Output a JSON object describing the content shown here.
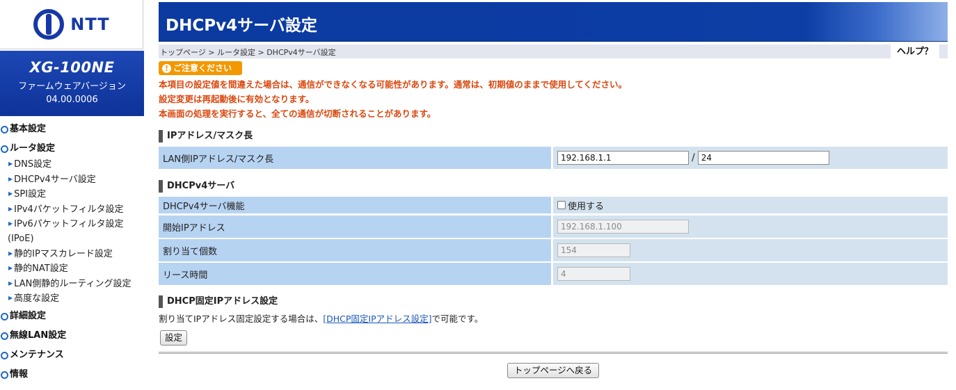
{
  "sidebar": {
    "logo_text": "NTT",
    "model_name": "XG-100NE",
    "firmware_label": "ファームウェアバージョン",
    "firmware_version": "04.00.0006",
    "menu": {
      "basic": "基本設定",
      "router": "ルータ設定",
      "router_items": [
        "DNS設定",
        "DHCPv4サーバ設定",
        "SPI設定",
        "IPv4パケットフィルタ設定",
        "IPv6パケットフィルタ設定",
        "(IPoE)",
        "静的IPマスカレード設定",
        "静的NAT設定",
        "LAN側静的ルーティング設定",
        "高度な設定"
      ],
      "detail": "詳細設定",
      "wlan": "無線LAN設定",
      "maintenance": "メンテナンス",
      "info": "情報"
    }
  },
  "header": {
    "title": "DHCPv4サーバ設定"
  },
  "breadcrumb": {
    "text": "トップページ > ルータ設定 > DHCPv4サーバ設定",
    "help": "ヘルプ？"
  },
  "caution": {
    "badge": "ご注意ください",
    "lines": [
      "本項目の設定値を間違えた場合は、通信ができなくなる可能性があります。通常は、初期値のままで使用してください。",
      "設定変更は再起動後に有効となります。",
      "本画面の処理を実行すると、全ての通信が切断されることがあります。"
    ]
  },
  "ip_section": {
    "title": "IPアドレス/マスク長",
    "lan_label": "LAN側IPアドレス/マスク長",
    "ip_value": "192.168.1.1",
    "slash": "/",
    "mask_value": "24"
  },
  "dhcp_section": {
    "title": "DHCPv4サーバ",
    "function_label": "DHCPv4サーバ機能",
    "use_label": "使用する",
    "start_label": "開始IPアドレス",
    "start_value": "192.168.1.100",
    "count_label": "割り当て個数",
    "count_value": "154",
    "lease_label": "リース時間",
    "lease_value": "4"
  },
  "fixed_section": {
    "title": "DHCP固定IPアドレス設定",
    "desc_before": "割り当てIPアドレス固定設定する場合は、",
    "link": "[DHCP固定IPアドレス設定]",
    "desc_after": "で可能です。",
    "set_button": "設定"
  },
  "footer": {
    "back_button": "トップページへ戻る"
  },
  "colors": {
    "header_blue": "#0d3ea5",
    "label_blue": "#b7d3f2",
    "value_bg": "#d3e2ee",
    "warning": "#d9480f",
    "badge": "#f39800"
  }
}
